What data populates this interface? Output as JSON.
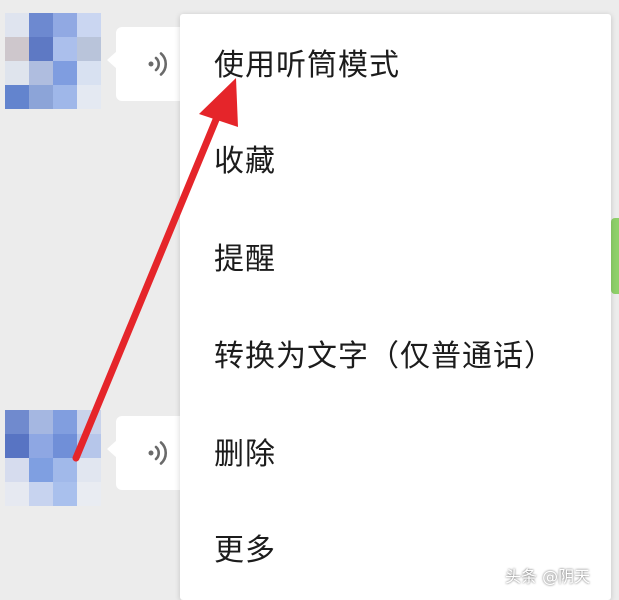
{
  "menu": {
    "items": [
      "使用听筒模式",
      "收藏",
      "提醒",
      "转换为文字（仅普通话）",
      "删除",
      "更多"
    ]
  },
  "chat": {
    "messages": [
      {
        "type": "voice",
        "icon": "voice-wave-icon"
      },
      {
        "type": "voice",
        "icon": "voice-wave-icon"
      }
    ]
  },
  "annotation": {
    "arrow_color": "#e5252a"
  },
  "watermark": "头条 @阴天"
}
